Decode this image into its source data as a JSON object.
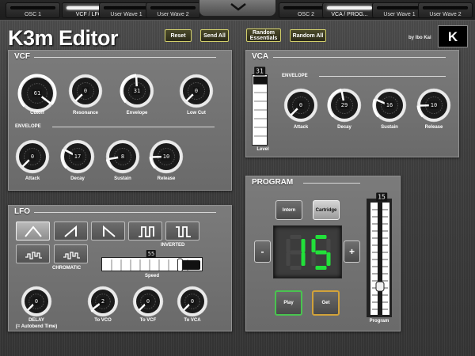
{
  "tabs": [
    {
      "label": "OSC 1",
      "active": false
    },
    {
      "label": "VCF / LFO",
      "active": true
    },
    {
      "label": "User Wave 1",
      "active": false
    },
    {
      "label": "User Wave 2",
      "active": false
    },
    {
      "label": "OSC 2",
      "active": false
    },
    {
      "label": "VCA / PROG...",
      "active": true
    },
    {
      "label": "User Wave 1",
      "active": false
    },
    {
      "label": "User Wave 2",
      "active": false
    }
  ],
  "header": {
    "title": "K3m Editor",
    "reset": "Reset",
    "send_all": "Send All",
    "random_essentials": "Random Essentials",
    "random_all": "Random All",
    "byline": "by Ibo Kai",
    "logo": "K"
  },
  "vcf": {
    "title": "VCF",
    "envelope": "ENVELOPE",
    "cutoff": {
      "label": "Cutoff",
      "value": "61",
      "pct": 0.97
    },
    "resonance": {
      "label": "Resonance",
      "value": "0",
      "pct": 0
    },
    "envelope_amt": {
      "label": "Envelope",
      "value": "31",
      "pct": 0.49
    },
    "low_cut": {
      "label": "Low Cut",
      "value": "0",
      "pct": 0
    },
    "attack": {
      "label": "Attack",
      "value": "0",
      "pct": 0
    },
    "decay": {
      "label": "Decay",
      "value": "17",
      "pct": 0.27
    },
    "sustain": {
      "label": "Sustain",
      "value": "8",
      "pct": 0.13
    },
    "release": {
      "label": "Release",
      "value": "10",
      "pct": 0.16
    }
  },
  "vca": {
    "title": "VCA",
    "envelope": "ENVELOPE",
    "level": {
      "label": "Level",
      "value": "31",
      "pct": 0.98
    },
    "attack": {
      "label": "Attack",
      "value": "0",
      "pct": 0
    },
    "decay": {
      "label": "Decay",
      "value": "29",
      "pct": 0.46
    },
    "sustain": {
      "label": "Sustain",
      "value": "16",
      "pct": 0.25
    },
    "release": {
      "label": "Release",
      "value": "10",
      "pct": 0.16
    }
  },
  "lfo": {
    "title": "LFO",
    "inverted": "INVERTED",
    "chromatic": "CHROMATIC",
    "speed": {
      "label": "Speed",
      "value": "55",
      "pct": 0.87
    },
    "delay": {
      "label": "DELAY",
      "sublabel": "(= Autobend Time)",
      "value": "0",
      "pct": 0
    },
    "to_vco": {
      "label": "To VCO",
      "value": "2",
      "pct": 0.03
    },
    "to_vcf": {
      "label": "To VCF",
      "value": "0",
      "pct": 0
    },
    "to_vca": {
      "label": "To VCA",
      "value": "0",
      "pct": 0
    },
    "selected_wave": "triangle"
  },
  "program": {
    "title": "PROGRAM",
    "intern": "Intern",
    "cartridge": "Cartridge",
    "minus": "-",
    "plus": "+",
    "display": "15",
    "play": "Play",
    "get": "Get",
    "slider_label": "Program",
    "slider_value": "15",
    "slider_pct": 0.23
  },
  "colors": {
    "accent_yellow": "#d3d06c",
    "lcd_green": "#22e03a",
    "play_border": "#49c44f",
    "get_border": "#d1a23a"
  }
}
